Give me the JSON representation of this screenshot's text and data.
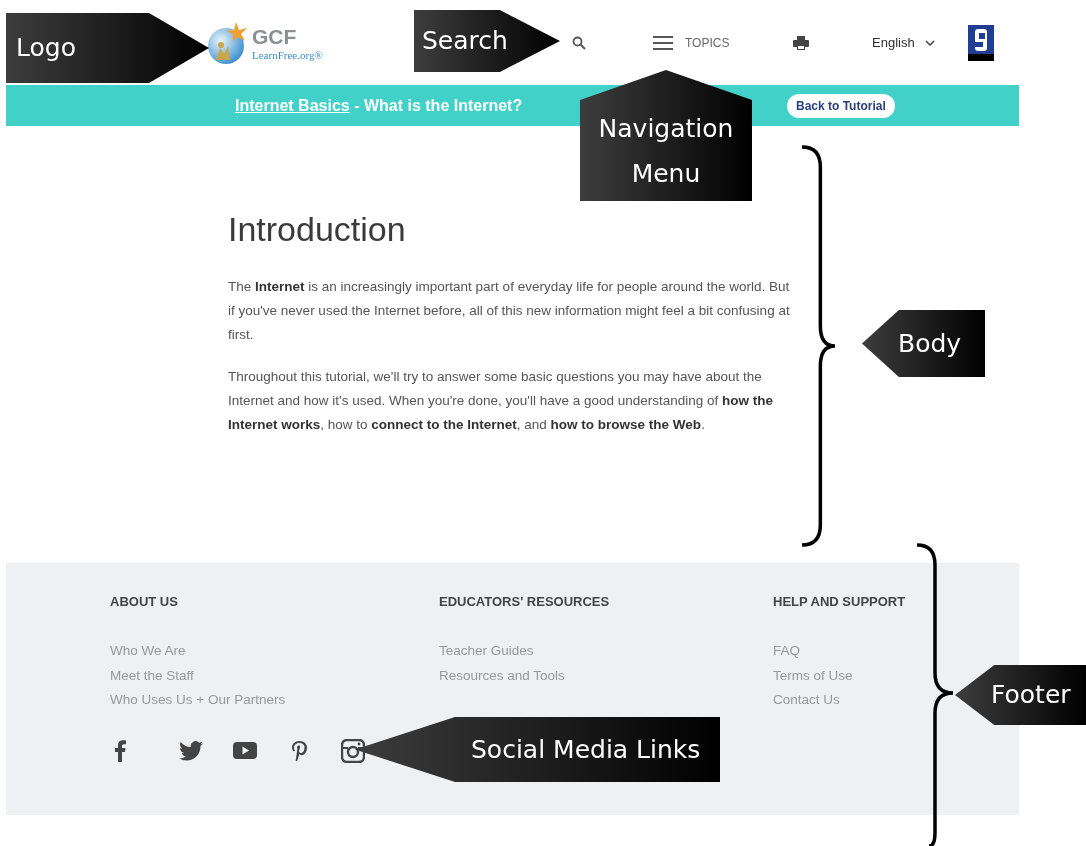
{
  "header": {
    "logo": {
      "mark": "GCF",
      "tagline": "LearnFree.org®"
    },
    "topics_label": "TOPICS",
    "language": "English"
  },
  "banner": {
    "course_link": "Internet Basics",
    "title": " - What is the Internet?",
    "button": "Back to Tutorial"
  },
  "article": {
    "heading": "Introduction",
    "paragraphs": [
      "The **Internet** is an increasingly important part of everyday life for people around the world. But if you've never used the Internet before, all of this new information might feel a bit confusing at first.",
      "Throughout this tutorial, we'll try to answer some basic questions you may have about the Internet and how it's used. When you're done, you'll have a good understanding of **how the Internet works**, how to **connect to the Internet**, and **how to browse the Web**."
    ]
  },
  "footer": {
    "columns": [
      {
        "heading": "ABOUT US",
        "links": [
          "Who We Are",
          "Meet the Staff",
          "Who Uses Us + Our Partners"
        ]
      },
      {
        "heading": "EDUCATORS' RESOURCES",
        "links": [
          "Teacher Guides",
          "Resources and Tools"
        ]
      },
      {
        "heading": "HELP AND SUPPORT",
        "links": [
          "FAQ",
          "Terms of Use",
          "Contact Us"
        ]
      }
    ]
  },
  "annotations": [
    {
      "kind": "right",
      "label": "Logo"
    },
    {
      "kind": "right",
      "label": "Search"
    },
    {
      "kind": "up",
      "label": "Navigation Menu"
    },
    {
      "kind": "left",
      "label": "Body"
    },
    {
      "kind": "left",
      "label": "Footer"
    },
    {
      "kind": "left",
      "label": "Social Media Links"
    }
  ]
}
